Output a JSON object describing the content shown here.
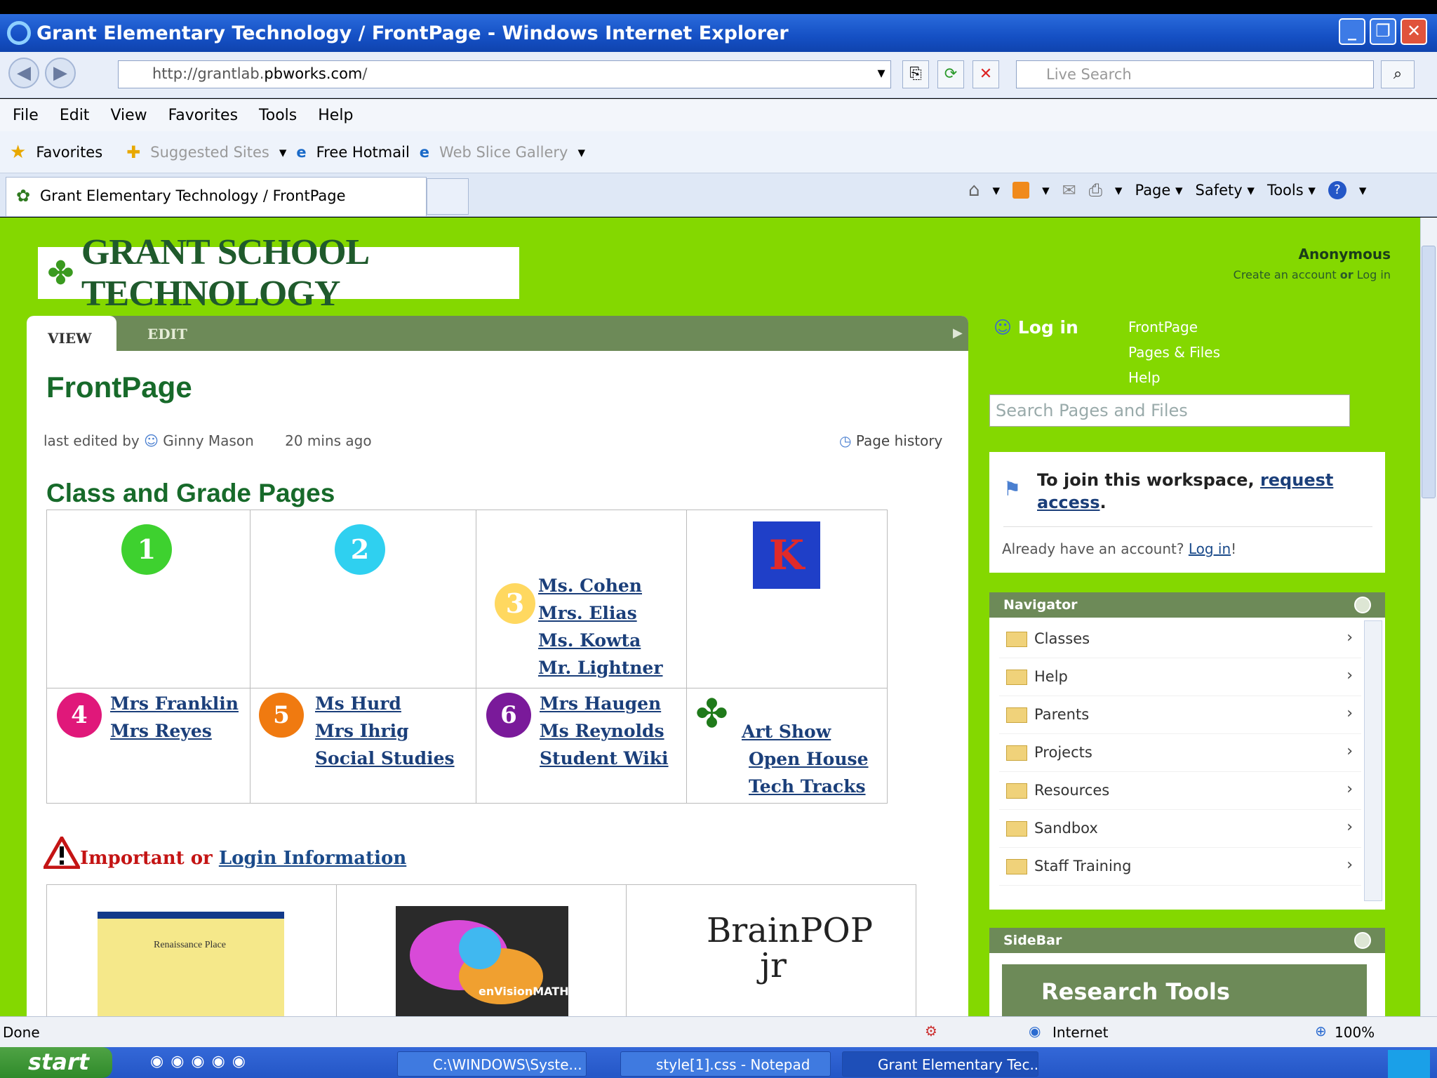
{
  "window": {
    "title": "Grant Elementary Technology / FrontPage - Windows Internet Explorer"
  },
  "address": {
    "url_prefix": "http://grantlab.",
    "url_domain": "pbworks.com",
    "url_suffix": "/",
    "search_placeholder": "Live Search"
  },
  "menu": [
    "File",
    "Edit",
    "View",
    "Favorites",
    "Tools",
    "Help"
  ],
  "favbar": {
    "favorites": "Favorites",
    "suggested": "Suggested Sites",
    "hotmail": "Free Hotmail",
    "webslice": "Web Slice Gallery"
  },
  "tab": {
    "label": "Grant Elementary Technology / FrontPage"
  },
  "commands": [
    "Page",
    "Safety",
    "Tools"
  ],
  "site": {
    "logo": "GRANT SCHOOL TECHNOLOGY",
    "user": "Anonymous",
    "create_account": "Create an account",
    "or": "or",
    "login_small": "Log in"
  },
  "page": {
    "view_tab": "VIEW",
    "edit_tab": "EDIT",
    "title": "FrontPage",
    "edited_by_prefix": "last edited by",
    "editor": "Ginny Mason",
    "edited_when": "20 mins ago",
    "history": "Page history",
    "class_heading": "Class and Grade Pages",
    "grades": {
      "g3": [
        "Ms. Cohen",
        "Mrs. Elias",
        "Ms. Kowta",
        "Mr. Lightner"
      ],
      "g4": [
        "Mrs Franklin",
        "Mrs Reyes"
      ],
      "g5": [
        "Ms Hurd",
        "Mrs Ihrig",
        "Social Studies"
      ],
      "g6": [
        "Mrs Haugen",
        "Ms Reynolds",
        "Student Wiki"
      ],
      "misc": [
        "Art Show",
        "Open House",
        "Tech Tracks"
      ]
    },
    "important_red": "Important or",
    "important_link": "Login Information",
    "images": {
      "renaissance": "Renaissance Place",
      "envision": "enVisionMATH",
      "brainpop": "BrainPOP jr"
    }
  },
  "side": {
    "login": "Log in",
    "links": [
      "FrontPage",
      "Pages & Files",
      "Help"
    ],
    "search_placeholder": "Search Pages and Files",
    "join_prefix": "To join this workspace,",
    "join_link": "request access",
    "join_suffix": ".",
    "already": "Already have an account?",
    "already_link": "Log in",
    "already_suffix": "!",
    "navigator_title": "Navigator",
    "nav_items": [
      "Classes",
      "Help",
      "Parents",
      "Projects",
      "Resources",
      "Sandbox",
      "Staff Training"
    ],
    "sidebar_title": "SideBar",
    "research": "Research Tools"
  },
  "status": {
    "left": "Done",
    "zone": "Internet",
    "zoom": "100%"
  },
  "taskbar": {
    "start": "start",
    "tasks": [
      "C:\\WINDOWS\\Syste...",
      "style[1].css - Notepad",
      "Grant Elementary Tec..."
    ]
  },
  "colors": {
    "page_bg": "#84d800",
    "accent_green": "#6d8a58",
    "title_green": "#176a2a"
  }
}
